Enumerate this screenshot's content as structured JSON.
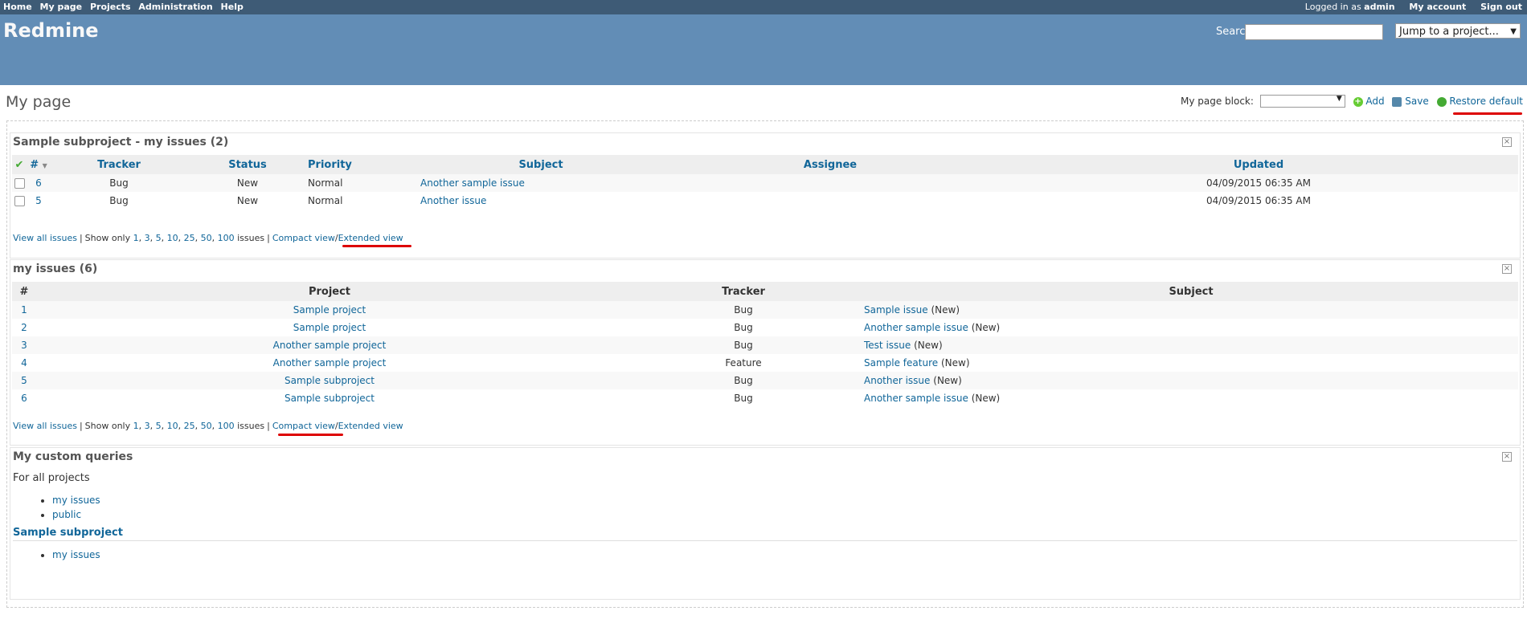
{
  "top_menu": {
    "items": [
      "Home",
      "My page",
      "Projects",
      "Administration",
      "Help"
    ],
    "logged_as_prefix": "Logged in as",
    "username": "admin",
    "my_account": "My account",
    "sign_out": "Sign out"
  },
  "header": {
    "title": "Redmine",
    "search_label": "Search:",
    "search_value": "",
    "jump_label": "Jump to a project..."
  },
  "page": {
    "title": "My page",
    "block_label": "My page block:",
    "block_value": "",
    "add": "Add",
    "save": "Save",
    "restore": "Restore default"
  },
  "block1": {
    "title": "Sample subproject - my issues (2)",
    "columns": [
      "#",
      "Tracker",
      "Status",
      "Priority",
      "Subject",
      "Assignee",
      "Updated"
    ],
    "rows": [
      {
        "id": "6",
        "tracker": "Bug",
        "status": "New",
        "priority": "Normal",
        "subject": "Another sample issue",
        "assignee": "",
        "updated": "04/09/2015 06:35 AM"
      },
      {
        "id": "5",
        "tracker": "Bug",
        "status": "New",
        "priority": "Normal",
        "subject": "Another issue",
        "assignee": "",
        "updated": "04/09/2015 06:35 AM"
      }
    ]
  },
  "footer": {
    "view_all": "View all issues",
    "show_only": "Show only",
    "counts": [
      "1",
      "3",
      "5",
      "10",
      "25",
      "50",
      "100"
    ],
    "issues_word": "issues",
    "compact": "Compact view",
    "extended": "Extended view"
  },
  "block2": {
    "title": "my issues (6)",
    "columns": [
      "#",
      "Project",
      "Tracker",
      "Subject"
    ],
    "rows": [
      {
        "id": "1",
        "project": "Sample project",
        "tracker": "Bug",
        "subject": "Sample issue",
        "status": "(New)"
      },
      {
        "id": "2",
        "project": "Sample project",
        "tracker": "Bug",
        "subject": "Another sample issue",
        "status": "(New)"
      },
      {
        "id": "3",
        "project": "Another sample project",
        "tracker": "Bug",
        "subject": "Test issue",
        "status": "(New)"
      },
      {
        "id": "4",
        "project": "Another sample project",
        "tracker": "Feature",
        "subject": "Sample feature",
        "status": "(New)"
      },
      {
        "id": "5",
        "project": "Sample subproject",
        "tracker": "Bug",
        "subject": "Another issue",
        "status": "(New)"
      },
      {
        "id": "6",
        "project": "Sample subproject",
        "tracker": "Bug",
        "subject": "Another sample issue",
        "status": "(New)"
      }
    ]
  },
  "block3": {
    "title": "My custom queries",
    "all_projects_heading": "For all projects",
    "all_projects_queries": [
      "my issues",
      "public"
    ],
    "project_heading": "Sample subproject",
    "project_queries": [
      "my issues"
    ]
  },
  "colors": {
    "top_menu": "#3e5b76",
    "header": "#628db6",
    "link": "#116699",
    "highlight_underline": "#dd0000"
  }
}
